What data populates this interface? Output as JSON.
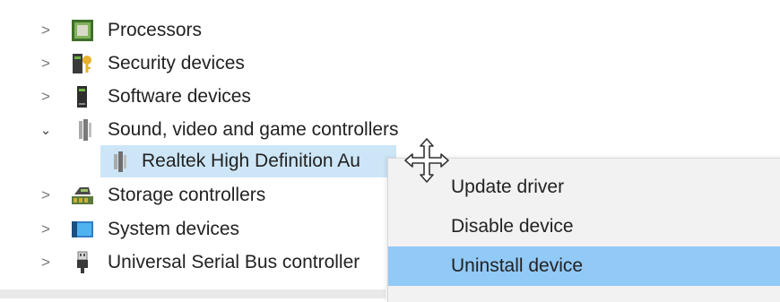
{
  "tree": {
    "items": [
      {
        "label": "Processors",
        "icon": "processor-icon",
        "expanded": false
      },
      {
        "label": "Security devices",
        "icon": "security-device-icon",
        "expanded": false
      },
      {
        "label": "Software devices",
        "icon": "software-device-icon",
        "expanded": false
      },
      {
        "label": "Sound, video and game controllers",
        "icon": "speaker-icon",
        "expanded": true
      },
      {
        "label": "Realtek High Definition Au",
        "icon": "speaker-icon",
        "selected": true
      },
      {
        "label": "Storage controllers",
        "icon": "storage-controller-icon",
        "expanded": false
      },
      {
        "label": "System devices",
        "icon": "system-device-icon",
        "expanded": false
      },
      {
        "label": "Universal Serial Bus controller",
        "icon": "usb-icon",
        "expanded": false
      }
    ],
    "chevron_collapsed": ">",
    "chevron_expanded": "⌄"
  },
  "context_menu": {
    "items": [
      {
        "label": "Update driver",
        "highlighted": false
      },
      {
        "label": "Disable device",
        "highlighted": false
      },
      {
        "label": "Uninstall device",
        "highlighted": true
      }
    ]
  },
  "colors": {
    "selection": "#cde6f7",
    "menu_highlight": "#91c9f7",
    "menu_background": "#f2f2f2"
  },
  "cursor": "move-cursor-icon"
}
